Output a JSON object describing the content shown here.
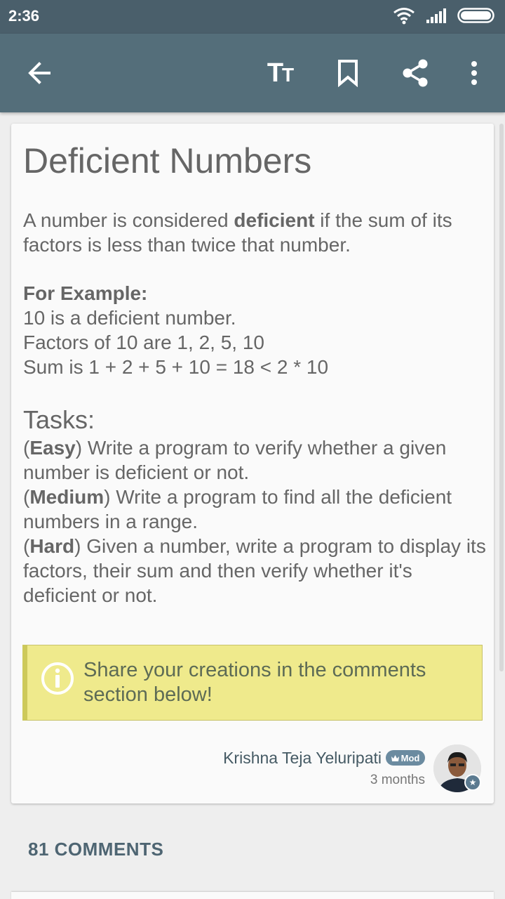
{
  "status_bar": {
    "time": "2:36",
    "icons": [
      "wifi-icon",
      "signal-icon",
      "battery-icon"
    ]
  },
  "toolbar": {
    "icons": [
      "back-arrow-icon",
      "text-size-icon",
      "bookmark-icon",
      "share-icon",
      "more-vert-icon"
    ],
    "text_size_big": "T",
    "text_size_small": "T"
  },
  "article": {
    "title": "Deficient Numbers",
    "intro": {
      "before": "A number is considered ",
      "bold": "deficient",
      "after": " if the sum of its factors is less than twice that number."
    },
    "example": {
      "heading": "For Example:",
      "lines": [
        "10 is a deficient number.",
        "Factors of 10 are 1, 2, 5, 10",
        "Sum is 1 + 2 + 5 + 10 = 18 < 2 * 10"
      ]
    },
    "tasks": {
      "heading": "Tasks:",
      "items": [
        {
          "level": "Easy",
          "text": " Write a program to verify whether a given number is deficient or not."
        },
        {
          "level": "Medium",
          "text": " Write a program to find all the deficient numbers in a range."
        },
        {
          "level": "Hard",
          "text": " Given a number, write a program to display its factors, their sum and then verify whether it's deficient or not."
        }
      ]
    },
    "callout": {
      "icon": "info-icon",
      "text": "Share your creations in the comments section below!"
    },
    "author": {
      "name": "Krishna Teja Yeluripati",
      "badge": "Mod",
      "time": "3 months"
    }
  },
  "comments": {
    "count_label": "81 COMMENTS"
  },
  "colors": {
    "status_bar": "#4a5f6b",
    "app_bar": "#546e7a",
    "callout_bg": "#efea8c",
    "callout_border": "#cdc95a",
    "accent": "#6b8ba0"
  }
}
